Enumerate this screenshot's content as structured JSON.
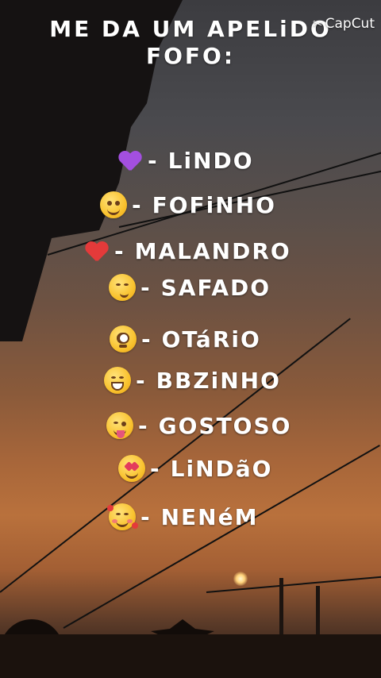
{
  "title": {
    "line1": "ME DA UM APELiDO",
    "line2": "FOFO:"
  },
  "watermark": {
    "icon": "capcut-icon",
    "label": "CapCut"
  },
  "items": [
    {
      "emoji": "purple-heart-icon",
      "dash": "-",
      "label": "LiNDO"
    },
    {
      "emoji": "smiling-face-icon",
      "dash": "-",
      "label": "FOFiNHO"
    },
    {
      "emoji": "red-heart-icon",
      "dash": "-",
      "label": "MALANDRO"
    },
    {
      "emoji": "smirking-face-icon",
      "dash": "-",
      "label": "SAFADO"
    },
    {
      "emoji": "flushed-face-icon",
      "dash": "-",
      "label": "OTáRiO"
    },
    {
      "emoji": "grinning-face-icon",
      "dash": "-",
      "label": "BBZiNHO"
    },
    {
      "emoji": "tongue-face-icon",
      "dash": "-",
      "label": "GOSTOSO"
    },
    {
      "emoji": "heart-eyes-face-icon",
      "dash": "-",
      "label": "LiNDãO"
    },
    {
      "emoji": "smiling-hearts-face-icon",
      "dash": "-",
      "label": "NENéM"
    }
  ],
  "colors": {
    "text": "#ffffff",
    "sky_top": "#3c3c40",
    "sky_sunset": "#b9713c"
  }
}
